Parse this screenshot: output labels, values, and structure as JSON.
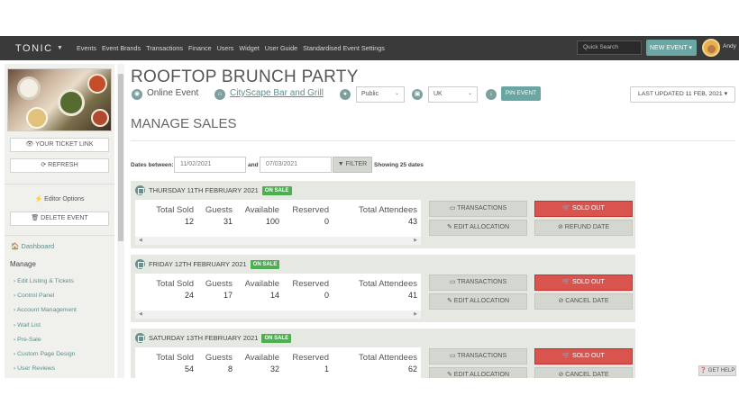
{
  "nav": {
    "logo": "TONIC",
    "links": [
      "Events",
      "Event Brands",
      "Transactions",
      "Finance",
      "Users",
      "Widget",
      "User Guide",
      "Standardised Event Settings"
    ],
    "search_placeholder": "Quick Search",
    "new_event": "NEW EVENT ▾",
    "username": "Andy"
  },
  "sidebar": {
    "ticket_link": "👁 YOUR TICKET LINK",
    "refresh": "⟳ REFRESH",
    "editor_options": "⚡ Editor Options",
    "delete_event": "🗑 DELETE EVENT",
    "dashboard": "🏠 Dashboard",
    "manage": "Manage",
    "items": [
      "› Edit Listing & Tickets",
      "› Control Panel",
      "› Account Management",
      "› Wait List",
      "› Pre-Sale",
      "› Custom Page Design",
      "› User Reviews"
    ]
  },
  "event": {
    "title": "ROOFTOP BRUNCH PARTY",
    "type": "Online Event",
    "venue": "CityScape Bar and Grill",
    "visibility": "Public",
    "country": "UK",
    "pin_event": "PIN EVENT",
    "last_updated": "LAST UPDATED 11 FEB, 2021 ▾"
  },
  "sales": {
    "heading": "MANAGE SALES",
    "dates_between_label": "Dates between:",
    "from_date": "11/02/2021",
    "and_label": "and",
    "to_date": "07/03/2021",
    "filter": "FILTER",
    "showing": "Showing 25 dates",
    "stat_labels": [
      "Total Sold",
      "Guests",
      "Available",
      "Reserved",
      "Total Attendees"
    ],
    "btn_transactions": "TRANSACTIONS",
    "btn_edit_allocation": "EDIT ALLOCATION",
    "btn_sold_out": "SOLD OUT",
    "dates": [
      {
        "label": "THURSDAY 11TH FEBRUARY 2021",
        "status": "ON SALE",
        "values": [
          "12",
          "31",
          "100",
          "0",
          "43"
        ],
        "secondary": "⊘ REFUND DATE"
      },
      {
        "label": "FRIDAY 12TH FEBRUARY 2021",
        "status": "ON SALE",
        "values": [
          "24",
          "17",
          "14",
          "0",
          "41"
        ],
        "secondary": "⊘ CANCEL DATE"
      },
      {
        "label": "SATURDAY 13TH FEBRUARY 2021",
        "status": "ON SALE",
        "values": [
          "54",
          "8",
          "32",
          "1",
          "62"
        ],
        "secondary": "⊘ CANCEL DATE"
      }
    ]
  },
  "help": "❓ GET HELP"
}
